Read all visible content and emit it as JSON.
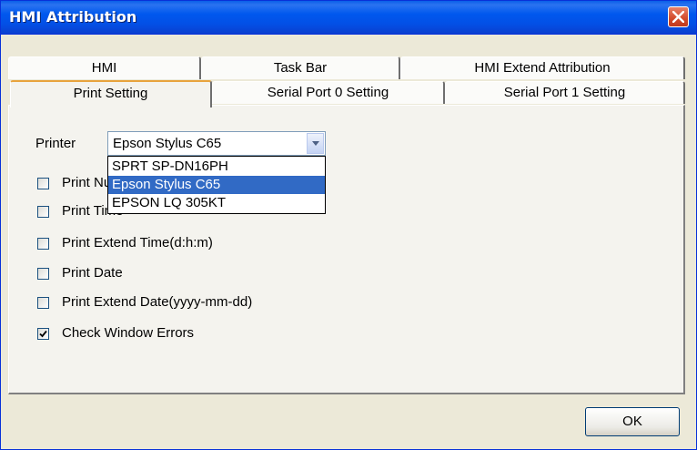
{
  "window": {
    "title": "HMI Attribution"
  },
  "tabs": {
    "back_row": [
      "HMI",
      "Task Bar",
      "HMI Extend Attribution"
    ],
    "front_row": [
      "Print Setting",
      "Serial Port 0 Setting",
      "Serial Port 1 Setting"
    ],
    "active": "Print Setting"
  },
  "printer": {
    "label": "Printer",
    "selected": "Epson Stylus C65",
    "options": [
      "SPRT SP-DN16PH",
      "Epson Stylus C65",
      "EPSON LQ 305KT"
    ]
  },
  "checkboxes": [
    {
      "label": "Print Number",
      "checked": false
    },
    {
      "label": "Print Time",
      "checked": false
    },
    {
      "label": "Print Extend Time(d:h:m)",
      "checked": false
    },
    {
      "label": "Print Date",
      "checked": false
    },
    {
      "label": "Print Extend Date(yyyy-mm-dd)",
      "checked": false
    },
    {
      "label": "Check Window Errors",
      "checked": true
    }
  ],
  "buttons": {
    "ok": "OK"
  },
  "colors": {
    "titlebar": "#0058ee",
    "selection": "#316ac5",
    "dialog_bg": "#ece9d8"
  }
}
